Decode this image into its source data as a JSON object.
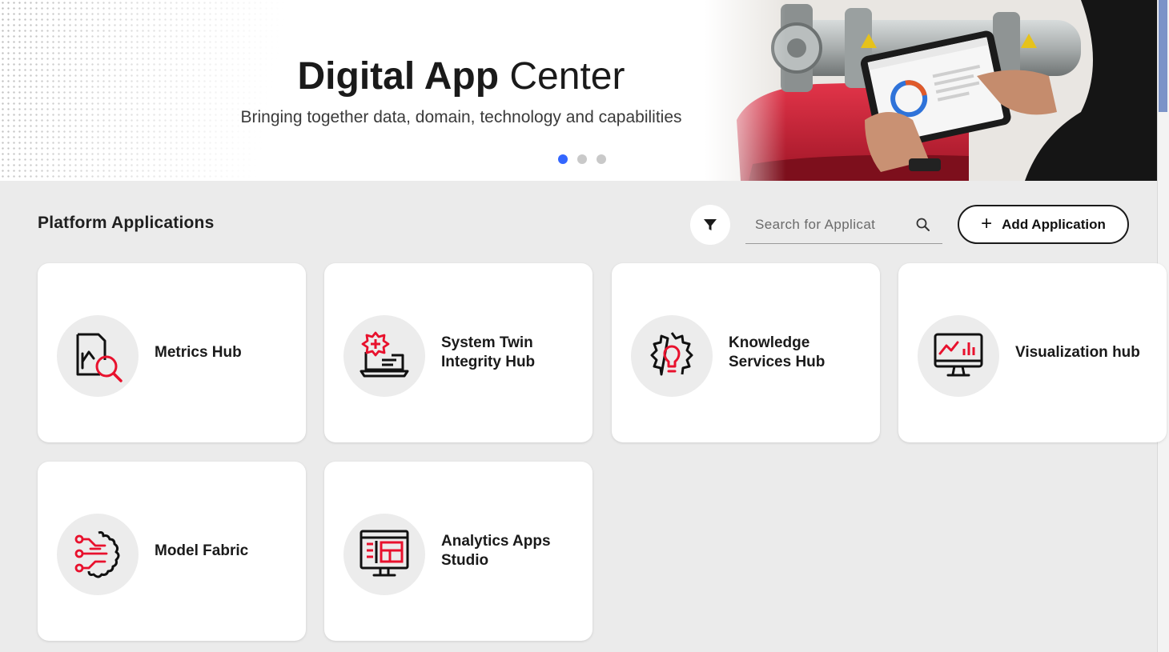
{
  "hero": {
    "title_bold": "Digital App",
    "title_light": "Center",
    "subtitle": "Bringing together data, domain, technology and capabilities",
    "slides": 3,
    "active_slide": 1
  },
  "toolbar": {
    "section_title": "Platform Applications",
    "filter_icon": "filter-icon",
    "search_placeholder": "Search for Applications",
    "search_icon": "search-icon",
    "add_label": "Add Application"
  },
  "colors": {
    "accent_red": "#e8112d",
    "carousel_active": "#3366ff",
    "background": "#ebebeb"
  },
  "applications": [
    {
      "name": "Metrics Hub",
      "icon": "metrics-search-icon"
    },
    {
      "name": "System Twin Integrity Hub",
      "icon": "system-twin-icon"
    },
    {
      "name": "Knowledge Services Hub",
      "icon": "gear-lightbulb-icon"
    },
    {
      "name": "Visualization hub",
      "icon": "monitor-chart-icon"
    },
    {
      "name": "Model Fabric",
      "icon": "model-fabric-icon"
    },
    {
      "name": "Analytics Apps Studio",
      "icon": "analytics-studio-icon"
    }
  ]
}
